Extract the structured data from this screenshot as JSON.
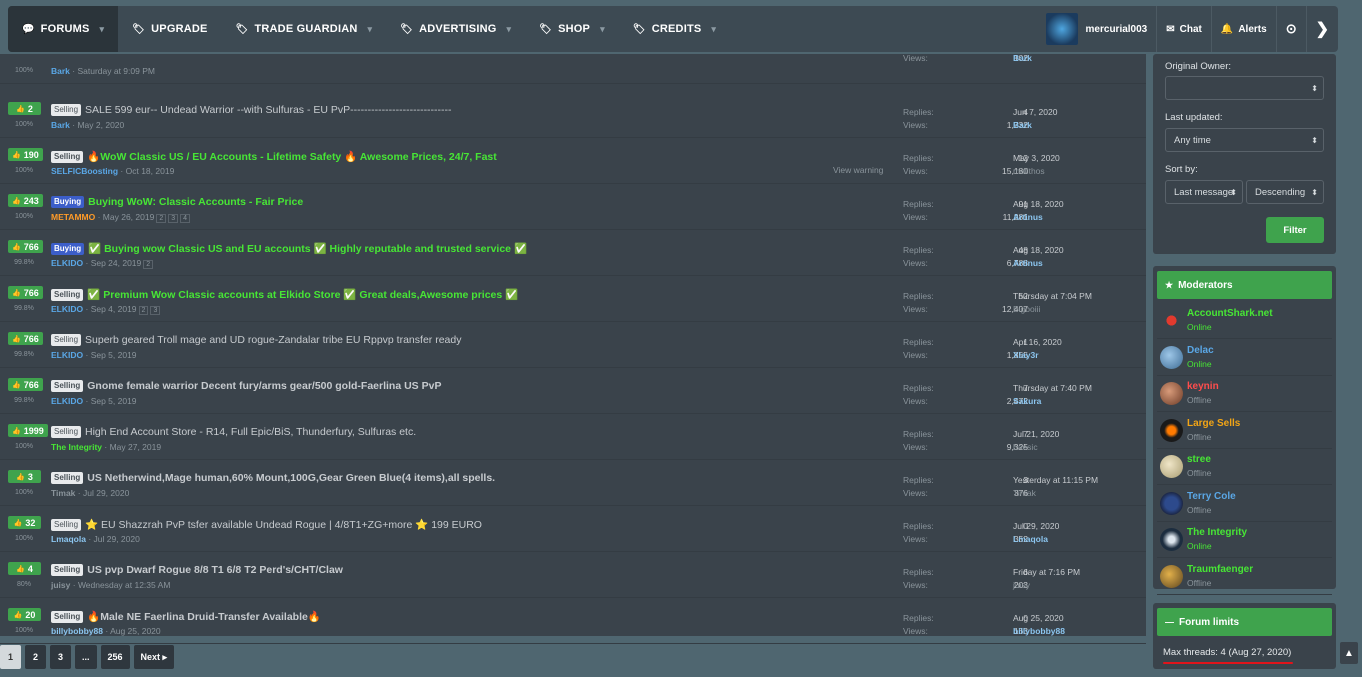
{
  "nav": {
    "forums": "FORUMS",
    "upgrade": "UPGRADE",
    "trade_guardian": "TRADE GUARDIAN",
    "advertising": "ADVERTISING",
    "shop": "SHOP",
    "credits": "CREDITS",
    "username": "mercurial003",
    "chat": "Chat",
    "alerts": "Alerts"
  },
  "threads": [
    {
      "rating": "",
      "pct": "100%",
      "prefix": "",
      "title": "",
      "author": "Bark",
      "date": "Saturday at 9:09 PM",
      "pages": [],
      "replies": "",
      "views": "102",
      "last_date": "",
      "last_user": "Bark",
      "warning": ""
    },
    {
      "rating": "2",
      "pct": "100%",
      "prefix": "Selling",
      "title": "SALE 599 eur-- Undead Warrior --with Sulfuras - EU PvP-----------------------------",
      "author": "Bark",
      "date": "May 2, 2020",
      "pages": [],
      "replies": "4",
      "views": "1,732",
      "last_date": "Jun 7, 2020",
      "last_user": "Bark",
      "warning": ""
    },
    {
      "rating": "190",
      "pct": "100%",
      "prefix": "Selling",
      "title": "🔥WoW Classic US / EU Accounts - Lifetime Safety 🔥 Awesome Prices, 24/7, Fast",
      "author": "SELFICBoosting",
      "date": "Oct 18, 2019",
      "pages": [],
      "replies": "12",
      "views": "15,180",
      "last_date": "May 3, 2020",
      "last_user": "malithos",
      "warning": "View warning"
    },
    {
      "rating": "243",
      "pct": "100%",
      "prefix": "Buying",
      "title": "Buying WoW: Classic Accounts - Fair Price",
      "author": "METAMMO",
      "date": "May 26, 2019",
      "pages": [
        "2",
        "3",
        "4"
      ],
      "replies": "91",
      "views": "11,281",
      "last_date": "Aug 18, 2020",
      "last_user": "Artinus",
      "warning": ""
    },
    {
      "rating": "766",
      "pct": "99.8%",
      "prefix": "Buying",
      "title": "✅ Buying wow Classic US and EU accounts ✅ Highly reputable and trusted service ✅",
      "author": "ELKIDO",
      "date": "Sep 24, 2019",
      "pages": [
        "2"
      ],
      "replies": "48",
      "views": "6,788",
      "last_date": "Aug 18, 2020",
      "last_user": "Artinus",
      "warning": ""
    },
    {
      "rating": "766",
      "pct": "99.8%",
      "prefix": "Selling",
      "title": "✅ Premium Wow Classic accounts at Elkido Store ✅ Great deals,Awesome prices ✅",
      "author": "ELKIDO",
      "date": "Sep 4, 2019",
      "pages": [
        "2",
        "3"
      ],
      "replies": "52",
      "views": "12,407",
      "last_date": "Thursday at 7:04 PM",
      "last_user": "Bigboiii",
      "warning": ""
    },
    {
      "rating": "766",
      "pct": "99.8%",
      "prefix": "Selling",
      "title": "Superb geared Troll mage and UD rogue-Zandalar tribe EU Rppvp transfer ready",
      "author": "ELKIDO",
      "date": "Sep 5, 2019",
      "pages": [],
      "replies": "1",
      "views": "1,855",
      "last_date": "Apr 16, 2020",
      "last_user": "Xlay3r",
      "warning": ""
    },
    {
      "rating": "766",
      "pct": "99.8%",
      "prefix": "Selling",
      "title": "Gnome female warrior Decent fury/arms gear/500 gold-Faerlina US PvP",
      "author": "ELKIDO",
      "date": "Sep 5, 2019",
      "pages": [],
      "replies": "7",
      "views": "2,472",
      "last_date": "Thursday at 7:40 PM",
      "last_user": "Sakura",
      "warning": ""
    },
    {
      "rating": "1999",
      "pct": "100%",
      "prefix": "Selling",
      "title": "High End Account Store - R14, Full Epic/BiS, Thunderfury, Sulfuras etc.",
      "author": "The Integrity",
      "date": "May 27, 2019",
      "pages": [],
      "replies": "7",
      "views": "9,325",
      "last_date": "Jul 21, 2020",
      "last_user": "baesic",
      "warning": ""
    },
    {
      "rating": "3",
      "pct": "100%",
      "prefix": "Selling",
      "title": "US Netherwind,Mage human,60% Mount,100G,Gear Green Blue(4 items),all spells.",
      "author": "Timak",
      "date": "Jul 29, 2020",
      "pages": [],
      "replies": "3",
      "views": "376",
      "last_date": "Yesterday at 11:15 PM",
      "last_user": "Timak",
      "warning": ""
    },
    {
      "rating": "32",
      "pct": "100%",
      "prefix": "Selling",
      "title": "⭐ EU Shazzrah PvP tsfer available Undead Rogue | 4/8T1+ZG+more ⭐ 199 EURO",
      "author": "Lmaqola",
      "date": "Jul 29, 2020",
      "pages": [],
      "replies": "0",
      "views": "352",
      "last_date": "Jul 29, 2020",
      "last_user": "Lmaqola",
      "warning": ""
    },
    {
      "rating": "4",
      "pct": "80%",
      "prefix": "Selling",
      "title": "US pvp Dwarf Rogue 8/8 T1 6/8 T2 Perd's/CHT/Claw",
      "author": "juisy",
      "date": "Wednesday at 12:35 AM",
      "pages": [],
      "replies": "6",
      "views": "203",
      "last_date": "Friday at 7:16 PM",
      "last_user": "juisy",
      "warning": ""
    },
    {
      "rating": "20",
      "pct": "100%",
      "prefix": "Selling",
      "title": "🔥Male NE Faerlina Druid-Transfer Available🔥",
      "author": "billybobby88",
      "date": "Aug 25, 2020",
      "pages": [],
      "replies": "0",
      "views": "163",
      "last_date": "Aug 25, 2020",
      "last_user": "billybobby88",
      "warning": ""
    }
  ],
  "labels": {
    "replies": "Replies:",
    "views": "Views:"
  },
  "pagination": [
    "1",
    "2",
    "3",
    "...",
    "256",
    "Next ▸"
  ],
  "filter": {
    "original_owner_label": "Original Owner:",
    "original_owner_value": "",
    "last_updated_label": "Last updated:",
    "last_updated_value": "Any time",
    "sort_by_label": "Sort by:",
    "sort_field": "Last message",
    "sort_dir": "Descending",
    "button": "Filter"
  },
  "moderators": {
    "title": "Moderators",
    "list": [
      {
        "name": "AccountShark.net",
        "status": "Online"
      },
      {
        "name": "Delac",
        "status": "Online"
      },
      {
        "name": "keynin",
        "status": "Offline"
      },
      {
        "name": "Large Sells",
        "status": "Offline"
      },
      {
        "name": "stree",
        "status": "Offline"
      },
      {
        "name": "Terry Cole",
        "status": "Offline"
      },
      {
        "name": "The Integrity",
        "status": "Online"
      },
      {
        "name": "Traumfaenger",
        "status": "Offline"
      }
    ]
  },
  "forum_limits": {
    "title": "Forum limits",
    "text": "Max threads: 4 (Aug 27, 2020)"
  },
  "colors": {
    "accent_green": "#3fa34d",
    "title_green": "#47e635",
    "link_blue": "#5aa7e6",
    "underline_red": "#e0141b"
  }
}
